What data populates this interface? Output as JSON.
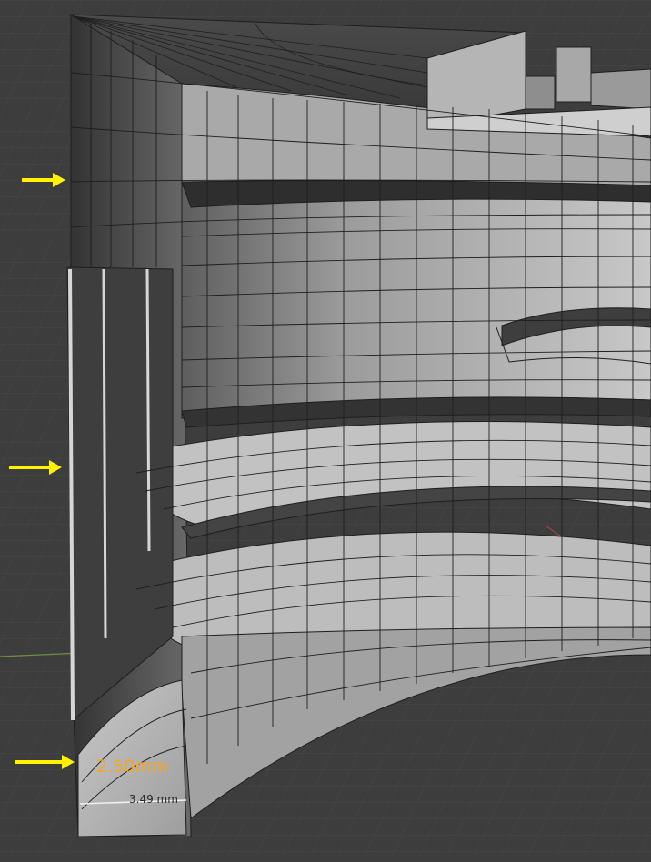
{
  "viewport": {
    "mode": "edit-mode",
    "measurements": [
      {
        "id": "primary",
        "value": "2.50mm",
        "color": "#f5a623"
      },
      {
        "id": "secondary",
        "value": "3.49 mm",
        "color": "#2a2a2a"
      }
    ]
  },
  "annotations": {
    "arrow_color": "#fff200",
    "arrows": [
      "upper-wall-arrow",
      "middle-wall-arrow",
      "base-ring-arrow"
    ]
  },
  "colors": {
    "background": "#3d3d3d",
    "grid": "#4a4a4a",
    "mesh_face": "#9a9a9a",
    "mesh_face_light": "#c4c4c4",
    "mesh_face_dark": "#4e4e4e",
    "wire": "#202020",
    "axis_x": "#c0504d",
    "axis_y": "#7aa23c"
  }
}
